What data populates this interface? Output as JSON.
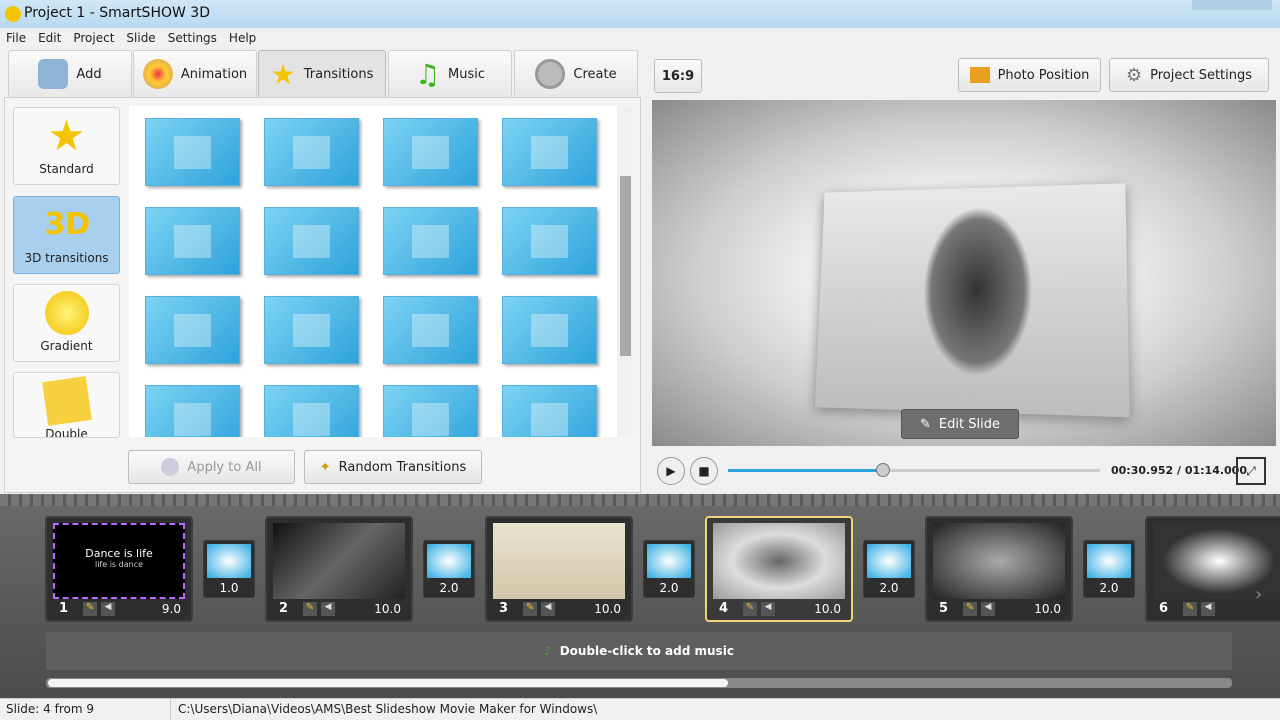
{
  "window": {
    "title": "Project 1 - SmartSHOW 3D"
  },
  "menu": [
    "File",
    "Edit",
    "Project",
    "Slide",
    "Settings",
    "Help"
  ],
  "tabs": [
    {
      "label": "Add",
      "icon": "camera-icon"
    },
    {
      "label": "Animation",
      "icon": "palette-icon"
    },
    {
      "label": "Transitions",
      "icon": "star-icon",
      "active": true
    },
    {
      "label": "Music",
      "icon": "music-note-icon"
    },
    {
      "label": "Create",
      "icon": "film-reel-icon"
    }
  ],
  "categories": [
    {
      "label": "Standard"
    },
    {
      "label": "3D transitions",
      "selected": true,
      "badge": "3D"
    },
    {
      "label": "Gradient"
    },
    {
      "label": "Double"
    }
  ],
  "buttons": {
    "apply_all": "Apply to All",
    "random": "Random Transitions",
    "aspect": "16:9",
    "photo_position": "Photo Position",
    "project_settings": "Project Settings",
    "edit_slide": "Edit Slide"
  },
  "player": {
    "time": "00:30.952 / 01:14.000",
    "progress": 0.418
  },
  "slides": [
    {
      "num": "1",
      "dur": "9.0",
      "title": "Dance is life",
      "subtitle": "life is dance"
    },
    {
      "num": "2",
      "dur": "10.0"
    },
    {
      "num": "3",
      "dur": "10.0"
    },
    {
      "num": "4",
      "dur": "10.0",
      "selected": true
    },
    {
      "num": "5",
      "dur": "10.0"
    },
    {
      "num": "6",
      "dur": ""
    }
  ],
  "transitions": [
    "1.0",
    "2.0",
    "2.0",
    "2.0",
    "2.0"
  ],
  "music_hint": "Double-click to add music",
  "status": {
    "slide": "Slide: 4 from 9",
    "path": "C:\\Users\\Diana\\Videos\\AMS\\Best Slideshow Movie Maker for Windows\\"
  },
  "colors": {
    "accent": "#2ea3dc",
    "selected_category": "#a9cfee",
    "selected_slide": "#f2d27a",
    "timeline": "#5a5a5a"
  }
}
